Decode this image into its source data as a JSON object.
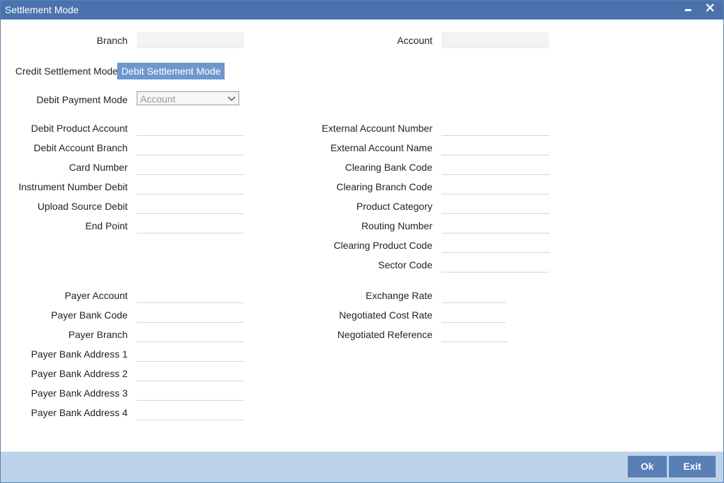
{
  "window": {
    "title": "Settlement Mode"
  },
  "header": {
    "branch_label": "Branch",
    "branch_value": "",
    "account_label": "Account",
    "account_value": ""
  },
  "tabs": [
    {
      "label": "Credit Settlement Mode",
      "active": false
    },
    {
      "label": "Debit Settlement Mode",
      "active": true
    }
  ],
  "debit_payment_mode": {
    "label": "Debit Payment Mode",
    "selected": "Account"
  },
  "left_fields": [
    {
      "label": "Debit Product Account",
      "value": ""
    },
    {
      "label": "Debit Account Branch",
      "value": ""
    },
    {
      "label": "Card Number",
      "value": ""
    },
    {
      "label": "Instrument Number Debit",
      "value": ""
    },
    {
      "label": "Upload Source Debit",
      "value": ""
    },
    {
      "label": "End Point",
      "value": ""
    }
  ],
  "right_fields": [
    {
      "label": "External Account Number",
      "value": ""
    },
    {
      "label": "External Account Name",
      "value": ""
    },
    {
      "label": "Clearing Bank Code",
      "value": ""
    },
    {
      "label": "Clearing Branch Code",
      "value": ""
    },
    {
      "label": "Product Category",
      "value": ""
    },
    {
      "label": "Routing Number",
      "value": ""
    },
    {
      "label": "Clearing Product Code",
      "value": ""
    },
    {
      "label": "Sector Code",
      "value": ""
    }
  ],
  "payer_fields": [
    {
      "label": "Payer Account",
      "value": ""
    },
    {
      "label": "Payer Bank Code",
      "value": ""
    },
    {
      "label": "Payer Branch",
      "value": ""
    },
    {
      "label": "Payer Bank Address 1",
      "value": ""
    },
    {
      "label": "Payer Bank Address 2",
      "value": ""
    },
    {
      "label": "Payer Bank Address 3",
      "value": ""
    },
    {
      "label": "Payer Bank Address 4",
      "value": ""
    }
  ],
  "rate_fields": [
    {
      "label": "Exchange Rate",
      "value": ""
    },
    {
      "label": "Negotiated Cost Rate",
      "value": ""
    },
    {
      "label": "Negotiated Reference",
      "value": ""
    }
  ],
  "footer": {
    "ok_label": "Ok",
    "exit_label": "Exit"
  },
  "colors": {
    "titlebar": "#4a73ad",
    "active_tab": "#6f97cf",
    "footer": "#bcd3ea",
    "button": "#5a7fb6"
  },
  "icons": {
    "minimize": "minimize-icon",
    "close": "close-icon",
    "dropdown": "chevron-down-icon"
  }
}
